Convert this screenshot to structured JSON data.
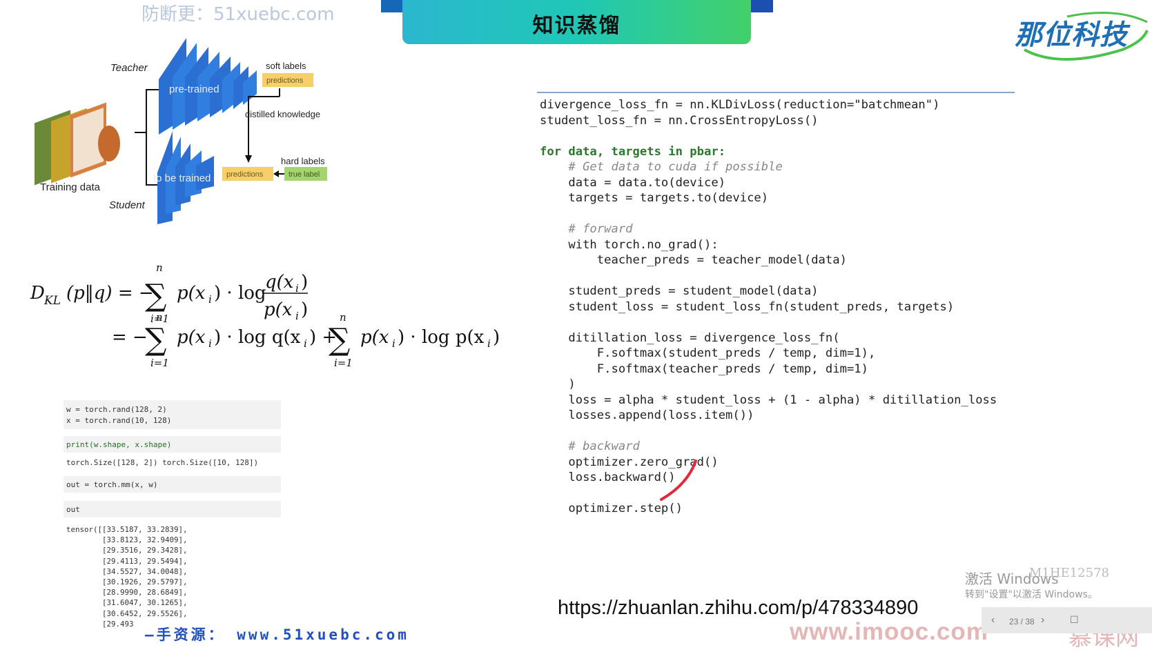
{
  "header": {
    "title": "知识蒸馏",
    "watermark_top": "防断更：51xuebc.com",
    "logo": "那位科技"
  },
  "diagram": {
    "teacher": "Teacher",
    "student": "Student",
    "training_data": "Training data",
    "pretrained": "pre-trained",
    "to_be_trained": "to be trained",
    "soft_labels": "soft labels",
    "predictions_top": "predictions",
    "distilled_knowledge": "distilled knowledge",
    "hard_labels": "hard labels",
    "predictions_bottom": "predictions",
    "true_label": "true label"
  },
  "formula": {
    "line1_lhs": "D",
    "line1_sub": "KL",
    "line1_args": "(p‖q) = −",
    "sum_top": "n",
    "sum_bottom": "i=1",
    "term1": "p(x",
    "term1b": ") · log",
    "frac_num": "q(x",
    "frac_den": "p(x",
    "line2_eq": "= −",
    "line2_t1": "p(x",
    "line2_t1b": ") · log q(x",
    "line2_plus": ") +",
    "line2_t2": "p(x",
    "line2_t2b": ") · log p(x",
    "close": ")",
    "i": "i"
  },
  "notebook": {
    "cell1_line1": "w = torch.rand(128, 2)",
    "cell1_line2": "x = torch.rand(10, 128)",
    "cell2": "print(w.shape, x.shape)",
    "cell2_out": "torch.Size([128, 2]) torch.Size([10, 128])",
    "cell3": "out = torch.mm(x, w)",
    "cell4": "out",
    "tensor_out": "tensor([[33.5187, 33.2839],\n        [33.8123, 32.9409],\n        [29.3516, 29.3428],\n        [29.4113, 29.5494],\n        [34.5527, 34.0048],\n        [30.1926, 29.5797],\n        [28.9990, 28.6849],\n        [31.6047, 30.1265],\n        [30.6452, 29.5526],\n        [29.493"
  },
  "code": {
    "l01": "divergence_loss_fn = nn.KLDivLoss(reduction=\"batchmean\")",
    "l02": "student_loss_fn = nn.CrossEntropyLoss()",
    "l04": "for data, targets in pbar:",
    "l05": "    # Get data to cuda if possible",
    "l06": "    data = data.to(device)",
    "l07": "    targets = targets.to(device)",
    "l09": "    # forward",
    "l10": "    with torch.no_grad():",
    "l11": "        teacher_preds = teacher_model(data)",
    "l13": "    student_preds = student_model(data)",
    "l14": "    student_loss = student_loss_fn(student_preds, targets)",
    "l16": "    ditillation_loss = divergence_loss_fn(",
    "l17": "        F.softmax(student_preds / temp, dim=1),",
    "l18": "        F.softmax(teacher_preds / temp, dim=1)",
    "l19": "    )",
    "l20": "    loss = alpha * student_loss + (1 - alpha) * ditillation_loss",
    "l21": "    losses.append(loss.item())",
    "l23": "    # backward",
    "l24": "    optimizer.zero_grad()",
    "l25": "    loss.backward()",
    "l27": "    optimizer.step()"
  },
  "footer": {
    "url": "https://zhuanlan.zhihu.com/p/478334890",
    "watermark_bottom": "—手资源： www.51xuebc.com",
    "imooc": "www.imooc.com",
    "imooc_cn": "慕课网",
    "activate_line1": "激活 Windows",
    "activate_line2": "转到\"设置\"以激活 Windows。",
    "user_id": "M1HE12578",
    "page_indicator": "23 / 38"
  },
  "colors": {
    "banner_start": "#2bb7cf",
    "banner_end": "#43d06a",
    "logo": "#1f6fb6",
    "net_blue": "#2a6fd1",
    "predictions_box": "#f6cf6a",
    "true_label_box": "#a5d46f",
    "annotation_red": "#e02a3a"
  }
}
